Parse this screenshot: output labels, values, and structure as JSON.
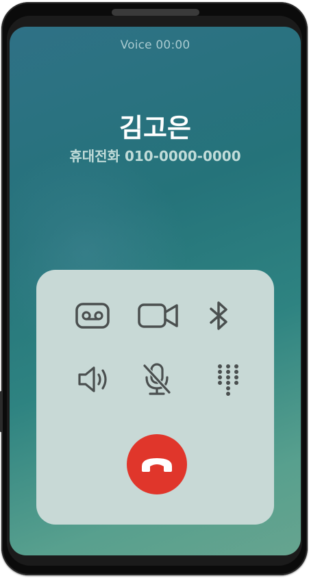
{
  "call": {
    "status": "Voice 00:00",
    "caller_name": "김고은",
    "caller_number": "휴대전화 010-0000-0000"
  },
  "controls": [
    {
      "name": "voicemail",
      "icon": "voicemail-icon"
    },
    {
      "name": "video-call",
      "icon": "video-camera-icon"
    },
    {
      "name": "bluetooth",
      "icon": "bluetooth-icon"
    },
    {
      "name": "speaker",
      "icon": "speaker-volume-icon"
    },
    {
      "name": "mute",
      "icon": "microphone-off-icon"
    },
    {
      "name": "keypad",
      "icon": "dialpad-icon"
    }
  ],
  "end_call": {
    "icon": "phone-hangup-icon",
    "color": "#e0362b"
  },
  "colors": {
    "screen_gradient_top": "#2f7186",
    "screen_gradient_bottom": "#66a48f",
    "panel": "#c8d9d6",
    "icon": "#4a4f4f"
  }
}
